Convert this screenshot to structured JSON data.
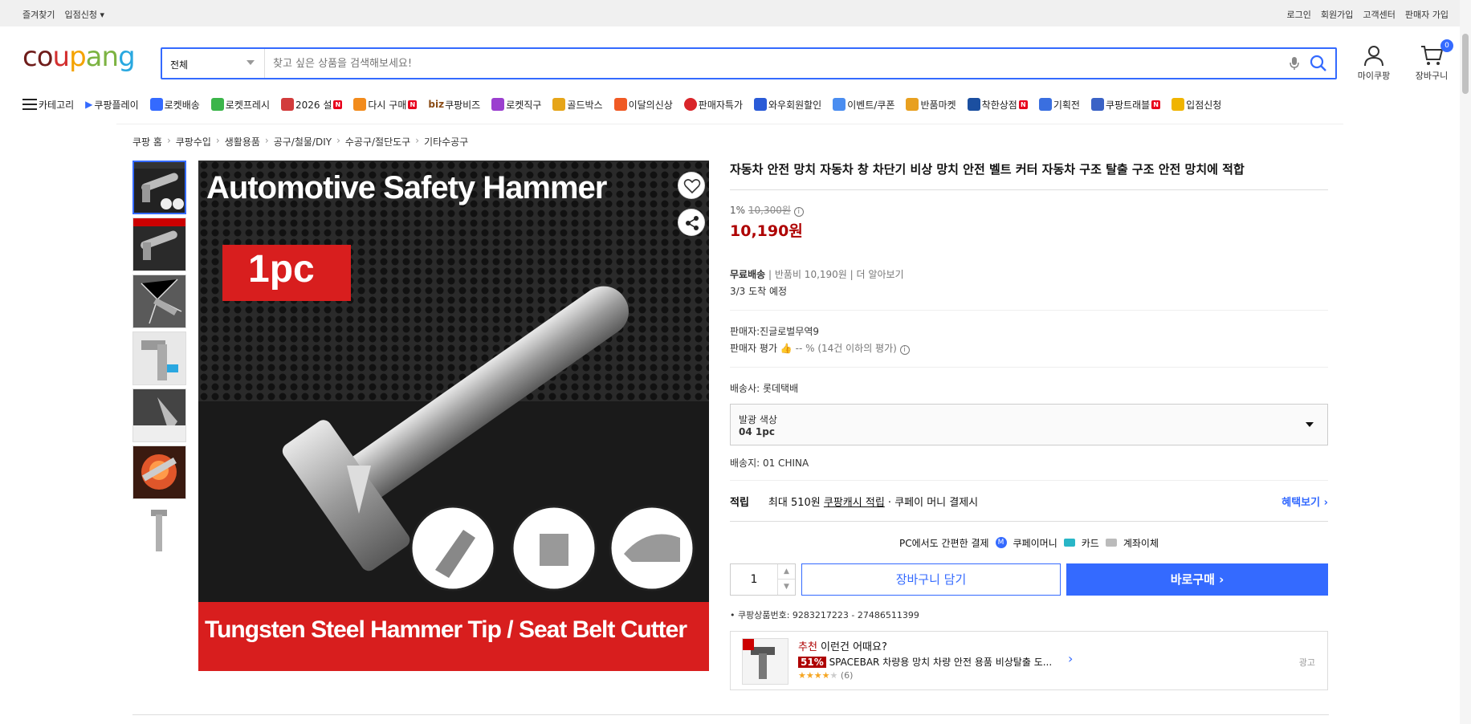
{
  "topbar": {
    "left": [
      "즐겨찾기",
      "입점신청"
    ],
    "right": [
      "로그인",
      "회원가입",
      "고객센터",
      "판매자 가입"
    ]
  },
  "header": {
    "logo": "coupang",
    "search_category": "전체",
    "search_placeholder": "찾고 싶은 상품을 검색해보세요!",
    "my_label": "마이쿠팡",
    "cart_label": "장바구니",
    "cart_count": "0"
  },
  "nav": {
    "category": "카테고리",
    "items": [
      "쿠팡플레이",
      "로켓배송",
      "로켓프레시",
      "2026 설",
      "다시 구매",
      "쿠팡비즈",
      "로켓직구",
      "골드박스",
      "이달의신상",
      "판매자특가",
      "와우회원할인",
      "이벤트/쿠폰",
      "반품마켓",
      "착한상점",
      "기획전",
      "쿠팡트래블",
      "입점신청"
    ],
    "biz": "biz"
  },
  "breadcrumb": [
    "쿠팡 홈",
    "쿠팡수입",
    "생활용품",
    "공구/철물/DIY",
    "수공구/절단도구",
    "기타수공구"
  ],
  "image": {
    "headline": "Automotive Safety Hammer",
    "tag": "1pc",
    "footer": "Tungsten Steel Hammer Tip / Seat Belt Cutter"
  },
  "product": {
    "title": "자동차 안전 망치 자동차 창 차단기 비상 망치 안전 벨트 커터 자동차 구조 탈출 구조 안전 망치에 적합",
    "discount_rate": "1%",
    "original_price": "10,300원",
    "price": "10,190원",
    "shipping_label": "무료배송",
    "return_fee": "반품비 10,190원",
    "learn_more": "더 알아보기",
    "arrival": "3/3 도착 예정",
    "seller": "판매자:진글로벌무역9",
    "seller_rating_label": "판매자 평가",
    "seller_rating_value": "-- % (14건 이하의 평가)",
    "courier": "배송사:  롯데택배",
    "option_label": "발광 색상",
    "option_value": "04 1pc",
    "ship_from": "배송지:  01 CHINA",
    "points_label": "적립",
    "points_text_pre": "최대 510원 ",
    "points_link": "쿠팡캐시 적립",
    "points_text_post": " · 쿠페이 머니 결제시",
    "benefit": "혜택보기",
    "pay_intro": "PC에서도 간편한 결제",
    "pay_methods": [
      "쿠페이머니",
      "카드",
      "계좌이체"
    ],
    "quantity": "1",
    "cart_button": "장바구니 담기",
    "buy_button": "바로구매",
    "product_id": "쿠팡상품번호: 9283217223 - 27486511399"
  },
  "recommend": {
    "prefix": "추천",
    "heading": " 이런건 어때요?",
    "discount": "51%",
    "name": "SPACEBAR 차량용 망치 차량 안전 용품 비상탈출 도...",
    "rating": 4,
    "reviews": "(6)",
    "ad": "광고"
  },
  "colors": {
    "accent": "#346aff",
    "price": "#ae0000"
  }
}
